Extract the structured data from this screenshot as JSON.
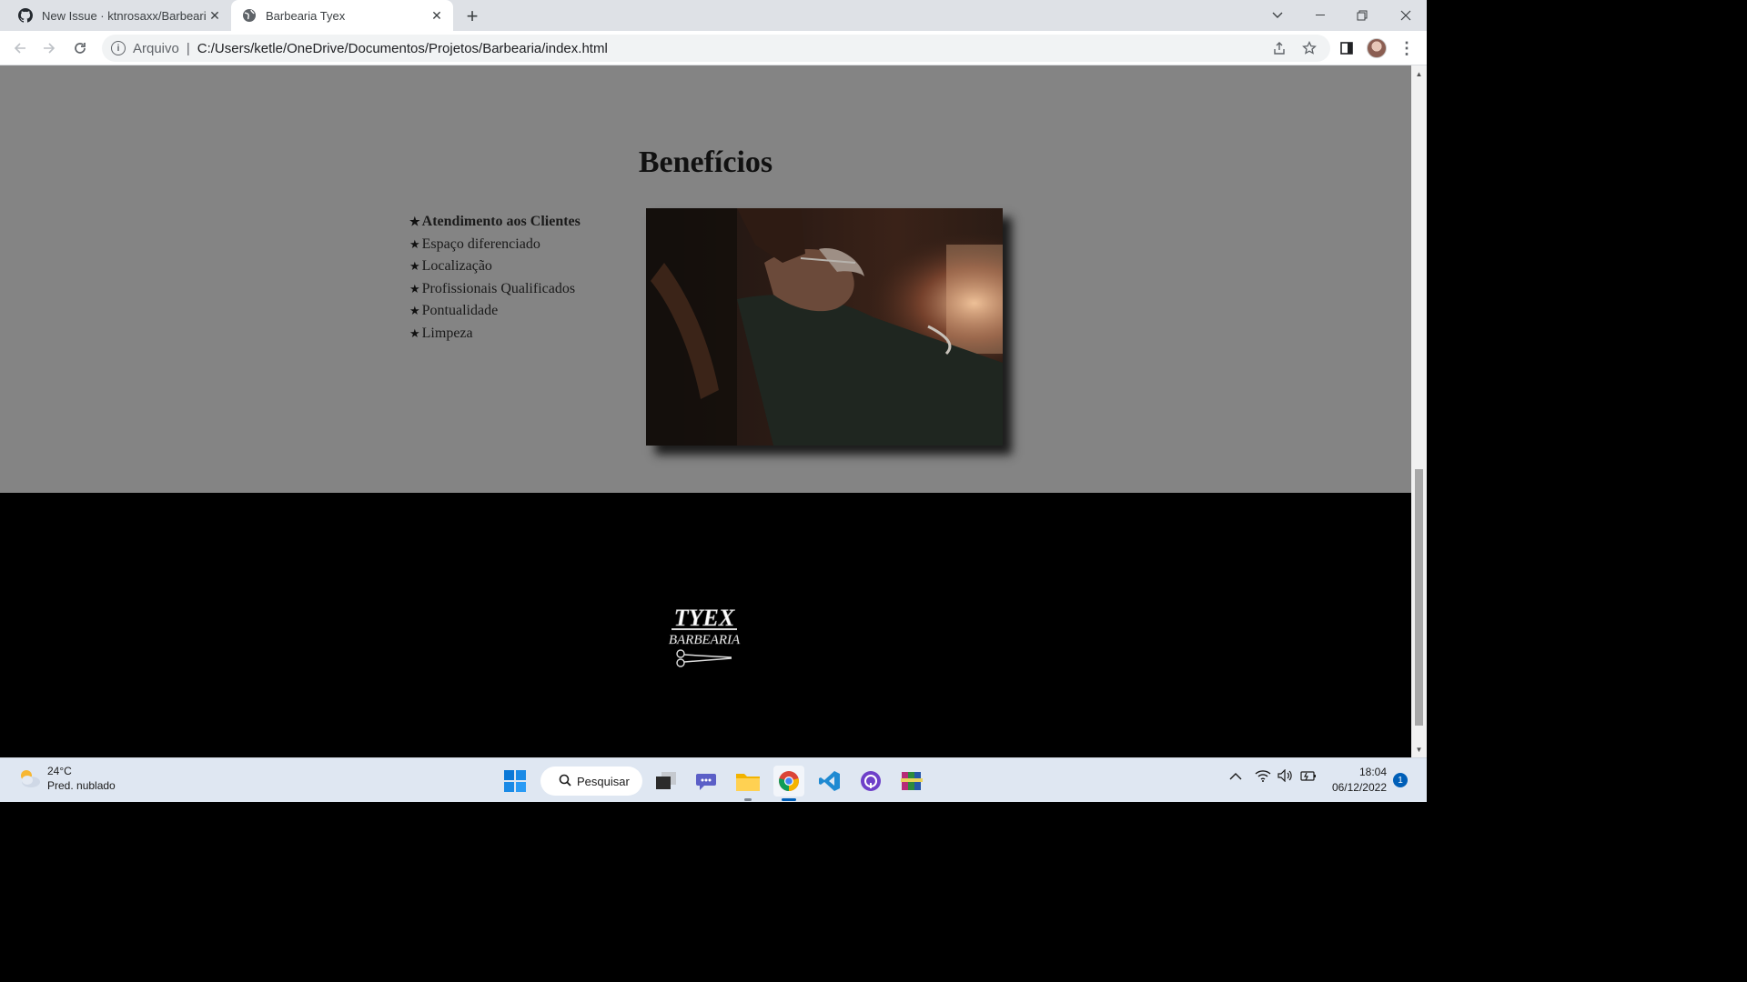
{
  "browser": {
    "tabs": [
      {
        "title": "New Issue · ktnrosaxx/Barbearia",
        "icon": "github-icon",
        "active": false
      },
      {
        "title": "Barbearia Tyex",
        "icon": "globe-icon",
        "active": true
      }
    ],
    "new_tab_label": "+",
    "address": {
      "scheme_label": "Arquivo",
      "separator": "|",
      "url": "C:/Users/ketle/OneDrive/Documentos/Projetos/Barbearia/index.html"
    }
  },
  "page": {
    "benefits": {
      "title": "Benefícios",
      "items": [
        {
          "label": "Atendimento aos Clientes",
          "bold": true
        },
        {
          "label": "Espaço diferenciado",
          "bold": false
        },
        {
          "label": "Localização",
          "bold": false
        },
        {
          "label": "Profissionais Qualificados",
          "bold": false
        },
        {
          "label": "Pontualidade",
          "bold": false
        },
        {
          "label": "Limpeza",
          "bold": false
        }
      ],
      "bullet": "★",
      "photo_alt": "barber-shaving-client-photo"
    },
    "footer": {
      "logo": {
        "word_top": "TYEX",
        "word_bottom": "BARBEARIA"
      }
    }
  },
  "taskbar": {
    "weather": {
      "temp": "24°C",
      "desc": "Pred. nublado"
    },
    "search_label": "Pesquisar",
    "clock": {
      "time": "18:04",
      "date": "06/12/2022"
    },
    "notification_count": "1"
  },
  "colors": {
    "page_section_bg": "#848484",
    "footer_bg": "#000000",
    "tabstrip_bg": "#dee1e6",
    "taskbar_bg": "#dfe7f2",
    "accent_blue": "#005fb8"
  }
}
